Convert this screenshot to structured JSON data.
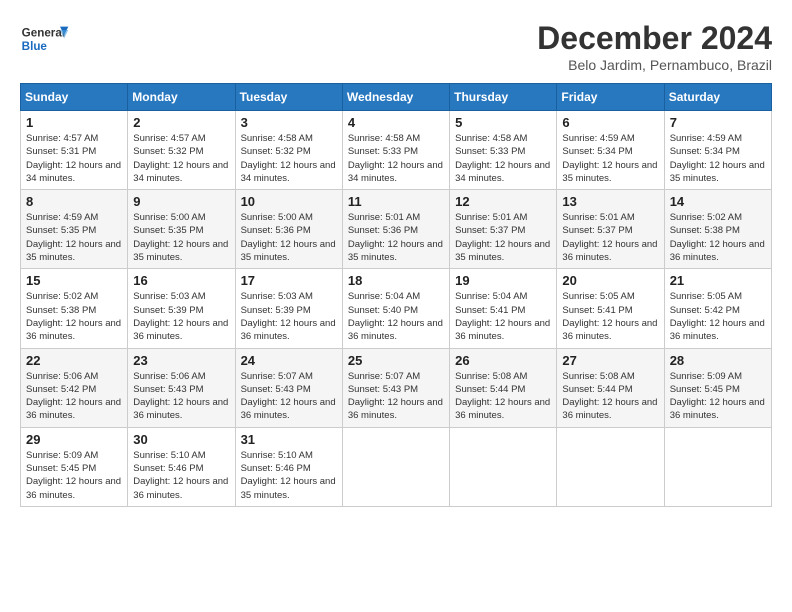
{
  "header": {
    "logo_line1": "General",
    "logo_line2": "Blue",
    "month_title": "December 2024",
    "location": "Belo Jardim, Pernambuco, Brazil"
  },
  "weekdays": [
    "Sunday",
    "Monday",
    "Tuesday",
    "Wednesday",
    "Thursday",
    "Friday",
    "Saturday"
  ],
  "weeks": [
    [
      {
        "day": 1,
        "sunrise": "4:57 AM",
        "sunset": "5:31 PM",
        "daylight": "12 hours and 34 minutes."
      },
      {
        "day": 2,
        "sunrise": "4:57 AM",
        "sunset": "5:32 PM",
        "daylight": "12 hours and 34 minutes."
      },
      {
        "day": 3,
        "sunrise": "4:58 AM",
        "sunset": "5:32 PM",
        "daylight": "12 hours and 34 minutes."
      },
      {
        "day": 4,
        "sunrise": "4:58 AM",
        "sunset": "5:33 PM",
        "daylight": "12 hours and 34 minutes."
      },
      {
        "day": 5,
        "sunrise": "4:58 AM",
        "sunset": "5:33 PM",
        "daylight": "12 hours and 34 minutes."
      },
      {
        "day": 6,
        "sunrise": "4:59 AM",
        "sunset": "5:34 PM",
        "daylight": "12 hours and 35 minutes."
      },
      {
        "day": 7,
        "sunrise": "4:59 AM",
        "sunset": "5:34 PM",
        "daylight": "12 hours and 35 minutes."
      }
    ],
    [
      {
        "day": 8,
        "sunrise": "4:59 AM",
        "sunset": "5:35 PM",
        "daylight": "12 hours and 35 minutes."
      },
      {
        "day": 9,
        "sunrise": "5:00 AM",
        "sunset": "5:35 PM",
        "daylight": "12 hours and 35 minutes."
      },
      {
        "day": 10,
        "sunrise": "5:00 AM",
        "sunset": "5:36 PM",
        "daylight": "12 hours and 35 minutes."
      },
      {
        "day": 11,
        "sunrise": "5:01 AM",
        "sunset": "5:36 PM",
        "daylight": "12 hours and 35 minutes."
      },
      {
        "day": 12,
        "sunrise": "5:01 AM",
        "sunset": "5:37 PM",
        "daylight": "12 hours and 35 minutes."
      },
      {
        "day": 13,
        "sunrise": "5:01 AM",
        "sunset": "5:37 PM",
        "daylight": "12 hours and 36 minutes."
      },
      {
        "day": 14,
        "sunrise": "5:02 AM",
        "sunset": "5:38 PM",
        "daylight": "12 hours and 36 minutes."
      }
    ],
    [
      {
        "day": 15,
        "sunrise": "5:02 AM",
        "sunset": "5:38 PM",
        "daylight": "12 hours and 36 minutes."
      },
      {
        "day": 16,
        "sunrise": "5:03 AM",
        "sunset": "5:39 PM",
        "daylight": "12 hours and 36 minutes."
      },
      {
        "day": 17,
        "sunrise": "5:03 AM",
        "sunset": "5:39 PM",
        "daylight": "12 hours and 36 minutes."
      },
      {
        "day": 18,
        "sunrise": "5:04 AM",
        "sunset": "5:40 PM",
        "daylight": "12 hours and 36 minutes."
      },
      {
        "day": 19,
        "sunrise": "5:04 AM",
        "sunset": "5:41 PM",
        "daylight": "12 hours and 36 minutes."
      },
      {
        "day": 20,
        "sunrise": "5:05 AM",
        "sunset": "5:41 PM",
        "daylight": "12 hours and 36 minutes."
      },
      {
        "day": 21,
        "sunrise": "5:05 AM",
        "sunset": "5:42 PM",
        "daylight": "12 hours and 36 minutes."
      }
    ],
    [
      {
        "day": 22,
        "sunrise": "5:06 AM",
        "sunset": "5:42 PM",
        "daylight": "12 hours and 36 minutes."
      },
      {
        "day": 23,
        "sunrise": "5:06 AM",
        "sunset": "5:43 PM",
        "daylight": "12 hours and 36 minutes."
      },
      {
        "day": 24,
        "sunrise": "5:07 AM",
        "sunset": "5:43 PM",
        "daylight": "12 hours and 36 minutes."
      },
      {
        "day": 25,
        "sunrise": "5:07 AM",
        "sunset": "5:43 PM",
        "daylight": "12 hours and 36 minutes."
      },
      {
        "day": 26,
        "sunrise": "5:08 AM",
        "sunset": "5:44 PM",
        "daylight": "12 hours and 36 minutes."
      },
      {
        "day": 27,
        "sunrise": "5:08 AM",
        "sunset": "5:44 PM",
        "daylight": "12 hours and 36 minutes."
      },
      {
        "day": 28,
        "sunrise": "5:09 AM",
        "sunset": "5:45 PM",
        "daylight": "12 hours and 36 minutes."
      }
    ],
    [
      {
        "day": 29,
        "sunrise": "5:09 AM",
        "sunset": "5:45 PM",
        "daylight": "12 hours and 36 minutes."
      },
      {
        "day": 30,
        "sunrise": "5:10 AM",
        "sunset": "5:46 PM",
        "daylight": "12 hours and 36 minutes."
      },
      {
        "day": 31,
        "sunrise": "5:10 AM",
        "sunset": "5:46 PM",
        "daylight": "12 hours and 35 minutes."
      },
      null,
      null,
      null,
      null
    ]
  ],
  "labels": {
    "sunrise": "Sunrise:",
    "sunset": "Sunset:",
    "daylight": "Daylight:"
  }
}
